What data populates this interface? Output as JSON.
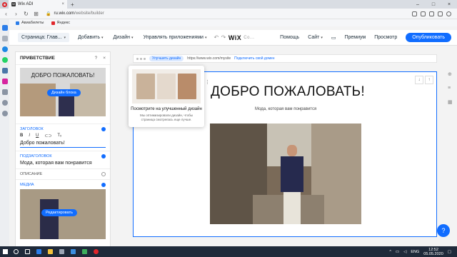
{
  "browser": {
    "tab_title": "Wix ADI",
    "tab_favicon": "W",
    "new_tab": "+",
    "url_host": "ru.wix.com",
    "url_path": "/website/builder",
    "bookmarks": [
      "Авиабилеты",
      "Яндекс"
    ]
  },
  "wix": {
    "page_selector": "Страница: Глав...",
    "menu": [
      "Добавить",
      "Дизайн",
      "Управлять приложениями"
    ],
    "logo": "WiX",
    "small_text": "Со...",
    "right_menu": [
      "Помощь",
      "Сайт"
    ],
    "premium": "Премиум",
    "preview": "Просмотр",
    "publish": "Опубликовать"
  },
  "panel": {
    "title": "ПРИВЕТСТВИЕ",
    "help": "?",
    "close": "×",
    "thumb_title": "ДОБРО ПОЖАЛОВАТЬ!",
    "thumb_button": "Дизайн блока",
    "heading_label": "ЗАГОЛОВОК",
    "format": [
      "B",
      "I",
      "U",
      "⊂⊃",
      "Tₓ"
    ],
    "heading_value": "Добро пожаловать!",
    "subheading_label": "ПОДЗАГОЛОВОК",
    "subheading_value": "Мода, которая вам понравится",
    "description_label": "ОПИСАНИЕ",
    "media_label": "МЕДИА",
    "media_button": "Редактировать"
  },
  "canvas": {
    "badge": "Улучшить дизайн",
    "site_url": "https://www.wix.com/mysite",
    "connect_domain": "Подключить свой домен",
    "title": "ДОБРО ПОЖАЛОВАТЬ!",
    "subtitle": "Мода, которая вам понравится"
  },
  "tooltip": {
    "title": "Посмотрите на улучшенный дизайн",
    "text": "Мы оптимизировали дизайн, чтобы страница смотрелась еще лучше."
  },
  "taskbar": {
    "lang": "ENG",
    "time": "12:52",
    "date": "05.05.2020"
  },
  "colors": {
    "accent": "#116dff",
    "opera_red": "#e0262b",
    "taskbar": "#1f2a3a"
  }
}
